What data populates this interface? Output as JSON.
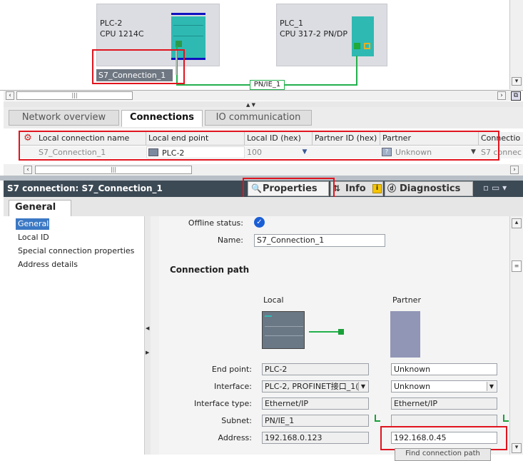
{
  "network": {
    "plc2_name": "PLC-2",
    "plc2_cpu": "CPU 1214C",
    "plc1_name": "PLC_1",
    "plc1_cpu": "CPU 317-2 PN/DP",
    "connection_label": "S7_Connection_1",
    "subnet_label": "PN/IE_1"
  },
  "tabs": [
    "Network overview",
    "Connections",
    "IO communication"
  ],
  "table": {
    "headers": [
      "Local connection name",
      "Local end point",
      "Local ID (hex)",
      "Partner ID (hex)",
      "Partner",
      "Connectio"
    ],
    "row": {
      "name": "S7_Connection_1",
      "local_end_point": "PLC-2",
      "local_id": "100",
      "partner_id": "",
      "partner": "Unknown",
      "connection": "S7 connec"
    }
  },
  "inspector": {
    "title": "S7 connection: S7_Connection_1",
    "tabs": [
      "Properties",
      "Info",
      "Diagnostics"
    ],
    "section_tab": "General",
    "nav": [
      "General",
      "Local ID",
      "Special connection properties",
      "Address details"
    ],
    "offline_status_label": "Offline status:",
    "name_label": "Name:",
    "name_value": "S7_Connection_1",
    "connection_path_title": "Connection path",
    "local_title": "Local",
    "partner_title": "Partner",
    "fields": {
      "end_point_label": "End point:",
      "interface_label": "Interface:",
      "interface_type_label": "Interface type:",
      "subnet_label": "Subnet:",
      "address_label": "Address:",
      "local_end_point": "PLC-2",
      "local_interface": "PLC-2, PROFINET接口_1(",
      "local_interface_type": "Ethernet/IP",
      "local_subnet": "PN/IE_1",
      "local_address": "192.168.0.123",
      "partner_end_point": "Unknown",
      "partner_interface": "Unknown",
      "partner_interface_type": "Ethernet/IP",
      "partner_subnet": "",
      "partner_address": "192.168.0.45",
      "find_path_button": "Find connection path"
    }
  },
  "colors": {
    "accent_red": "#e0141e",
    "connection_green": "#22b14c",
    "inspector_header": "#3c4a55",
    "selection_blue": "#3b78c4"
  }
}
